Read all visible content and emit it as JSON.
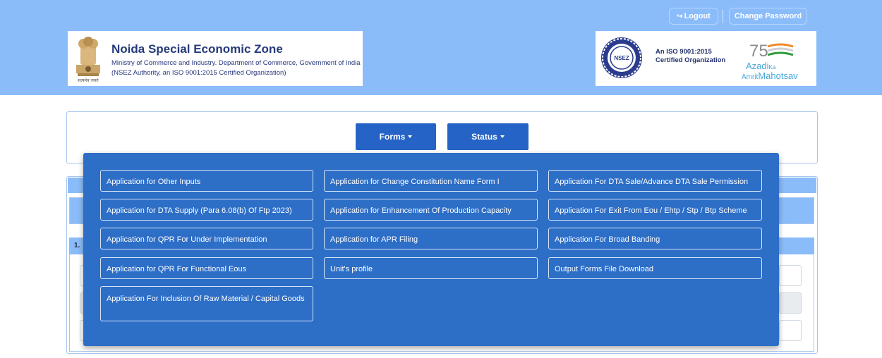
{
  "header": {
    "logout_icon": "↪",
    "logout_label": "Logout",
    "change_password_label": "Change Password",
    "org_title": "Noida Special Economic Zone",
    "org_subtitle_line1": "Ministry of Commerce and Industry. Department of Commerce, Government of India",
    "org_subtitle_line2": "(NSEZ Authority, an ISO 9001:2015 Certified Organization)",
    "emblem_caption": "सत्यमेव जयते",
    "seal_text": "NSEZ",
    "iso_line1": "An ISO 9001:2015",
    "iso_line2": "Certified Organization",
    "azadi_number": "75",
    "azadi_word": "Azadi",
    "azadi_ka": "Ka",
    "azadi_amrit": "Amrit",
    "azadi_mahotsav": "Mahotsav"
  },
  "nav": {
    "forms_label": "Forms",
    "status_label": "Status"
  },
  "background": {
    "section_number": "1."
  },
  "forms_menu": {
    "items": [
      "Application for Other Inputs",
      "Application for Change Constitution Name Form I",
      "Application For DTA Sale/Advance DTA Sale Permission",
      "Application for DTA Supply (Para 6.08(b) Of Ftp 2023)",
      "Application for Enhancement Of Production Capacity",
      "Application For Exit From Eou / Ehtp / Stp / Btp Scheme",
      "Application for QPR For Under Implementation",
      "Application for APR Filing",
      "Application For Broad Banding",
      "Application for QPR For Functional Eous",
      "Unit's profile",
      "Output Forms File Download",
      "Application For Inclusion Of Raw Material / Capital Goods"
    ]
  },
  "colors": {
    "header_bg": "#8bbcfa",
    "primary_button": "#2563c6",
    "dropdown_bg": "#2d6ec7",
    "brand_text": "#253a7a"
  },
  "icons": [
    "logout-icon",
    "national-emblem-icon",
    "nsez-seal-icon",
    "azadi-ka-amrit-mahotsav-logo",
    "caret-down-icon"
  ]
}
